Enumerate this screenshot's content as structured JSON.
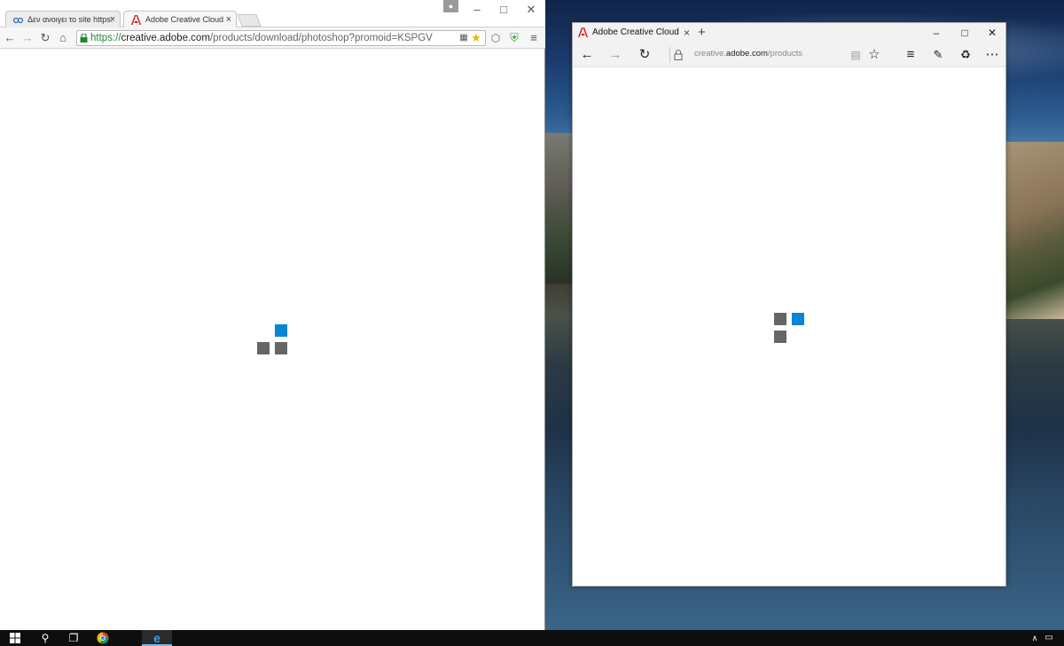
{
  "desktop": {
    "wallpaper": "mountain-lake-landscape"
  },
  "chrome": {
    "tabs": [
      {
        "label": "Δεν ανοιγει το site https:",
        "icon": "greek-forum-favicon-icon",
        "active": false
      },
      {
        "label": "Adobe Creative Cloud",
        "icon": "adobe-icon",
        "active": true
      }
    ],
    "toolbar": {
      "url_scheme": "https://",
      "url_host": "creative.adobe.com",
      "url_path": "/products/download/photoshop?promoid=KSPGV"
    },
    "loader_colors": {
      "grey": "#666666",
      "blue": "#0a84d6"
    }
  },
  "edge": {
    "tab_label": "Adobe Creative Cloud",
    "address": {
      "prefix": "creative.",
      "host": "adobe.com",
      "path": "/products"
    }
  },
  "taskbar": {
    "items": [
      "start-icon",
      "search-icon",
      "task-view-icon",
      "chrome-icon",
      "edge-icon"
    ],
    "accent": "#76b9ed"
  }
}
